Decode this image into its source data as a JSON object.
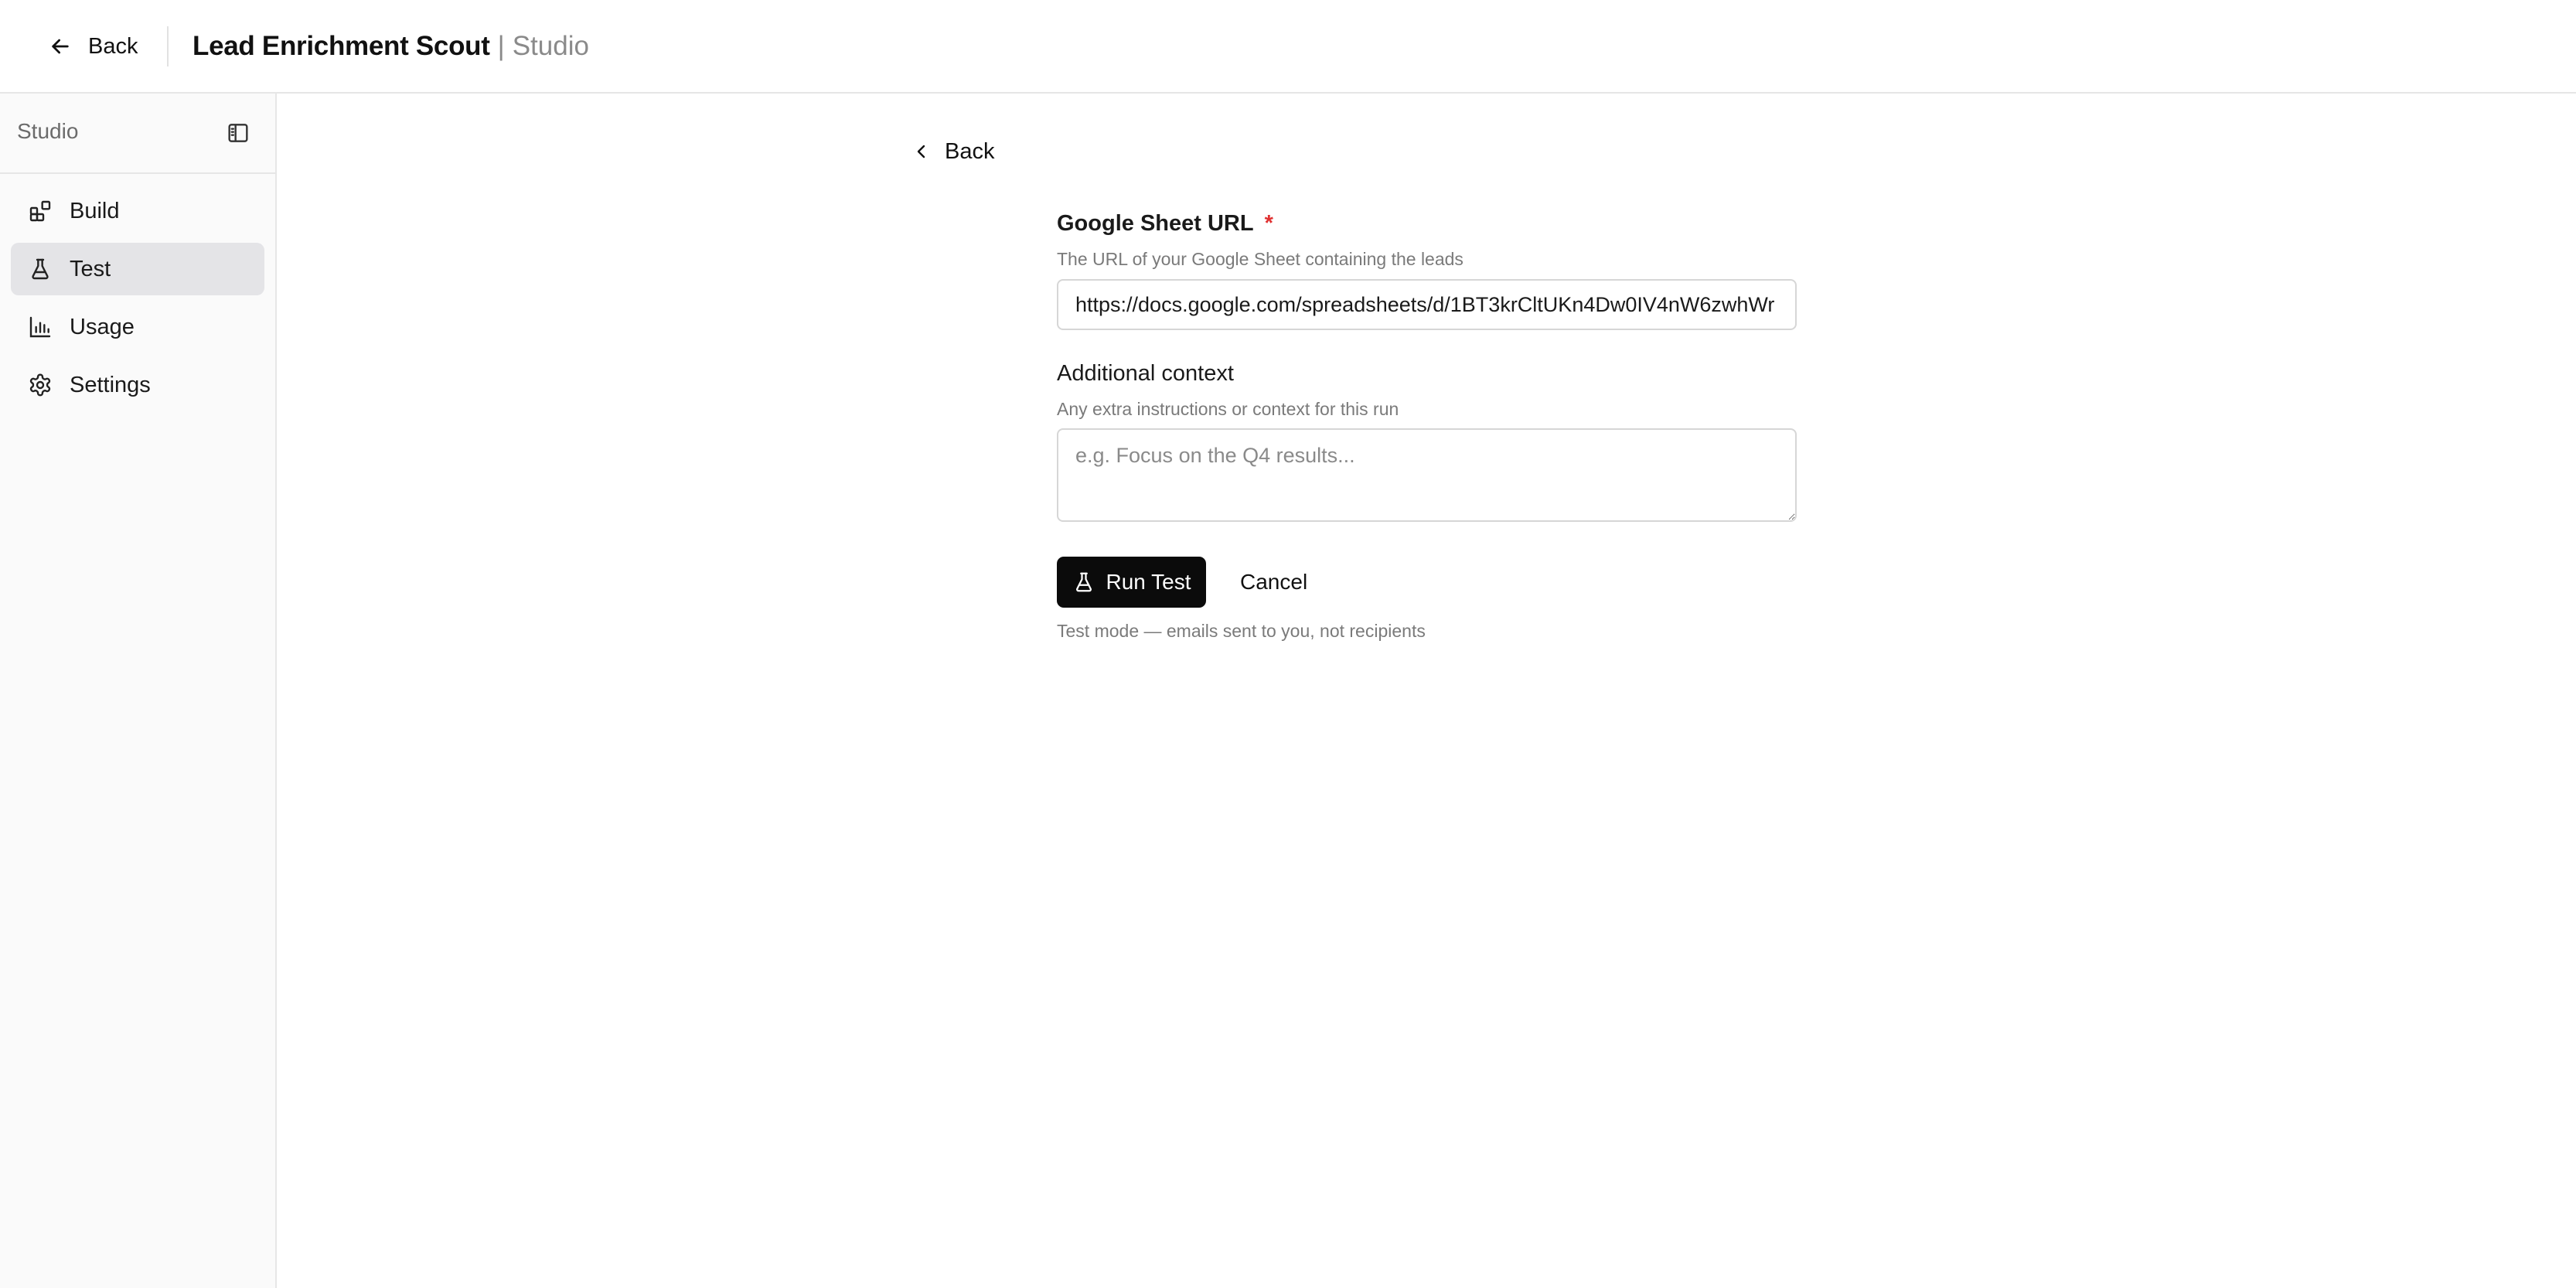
{
  "header": {
    "back_label": "Back",
    "app_name": "Lead Enrichment Scout",
    "separator": "|",
    "app_suffix": "Studio"
  },
  "sidebar": {
    "title": "Studio",
    "items": [
      {
        "label": "Build",
        "icon": "blocks-icon",
        "active": false
      },
      {
        "label": "Test",
        "icon": "flask-icon",
        "active": true
      },
      {
        "label": "Usage",
        "icon": "bar-chart-icon",
        "active": false
      },
      {
        "label": "Settings",
        "icon": "gear-icon",
        "active": false
      }
    ]
  },
  "main": {
    "back_label": "Back",
    "sheet_url": {
      "label": "Google Sheet URL",
      "required_mark": "*",
      "help": "The URL of your Google Sheet containing the leads",
      "value": "https://docs.google.com/spreadsheets/d/1BT3krCltUKn4Dw0IV4nW6zwhWr"
    },
    "context": {
      "label": "Additional context",
      "help": "Any extra instructions or context for this run",
      "value": "",
      "placeholder": "e.g. Focus on the Q4 results..."
    },
    "run_label": "Run Test",
    "cancel_label": "Cancel",
    "note": "Test mode — emails sent to you, not recipients"
  },
  "colors": {
    "primary_button": "#0b0b0b",
    "required": "#e03131",
    "active_nav": "#e4e4e7"
  }
}
